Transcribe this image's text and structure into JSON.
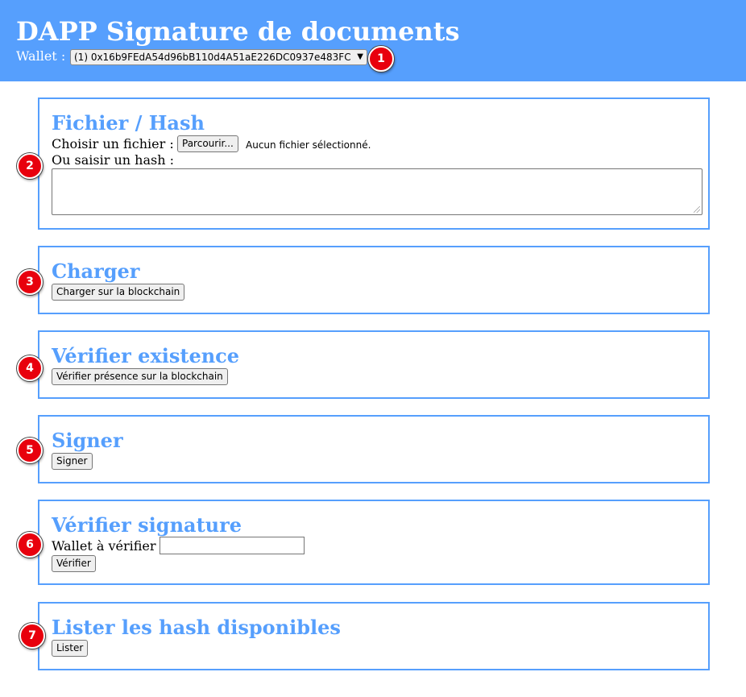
{
  "header": {
    "title": "DAPP Signature de documents",
    "wallet_label": "Wallet :",
    "wallet_selected": "(1) 0x16b9FEdA54d96bB110d4A51aE226DC0937e483FC"
  },
  "sections": {
    "fichier": {
      "title": "Fichier / Hash",
      "choose_file_label": "Choisir un fichier :",
      "browse_button": "Parcourir...",
      "no_file_text": "Aucun fichier sélectionné.",
      "hash_label": "Ou saisir un hash :",
      "hash_value": ""
    },
    "charger": {
      "title": "Charger",
      "button": "Charger sur la blockchain"
    },
    "verifier_existence": {
      "title": "Vérifier existence",
      "button": "Vérifier présence sur la blockchain"
    },
    "signer": {
      "title": "Signer",
      "button": "Signer"
    },
    "verifier_signature": {
      "title": "Vérifier signature",
      "wallet_label": "Wallet à vérifier",
      "wallet_value": "",
      "button": "Vérifier"
    },
    "lister": {
      "title": "Lister les hash disponibles",
      "button": "Lister"
    }
  },
  "markers": [
    "1",
    "2",
    "3",
    "4",
    "5",
    "6",
    "7"
  ]
}
